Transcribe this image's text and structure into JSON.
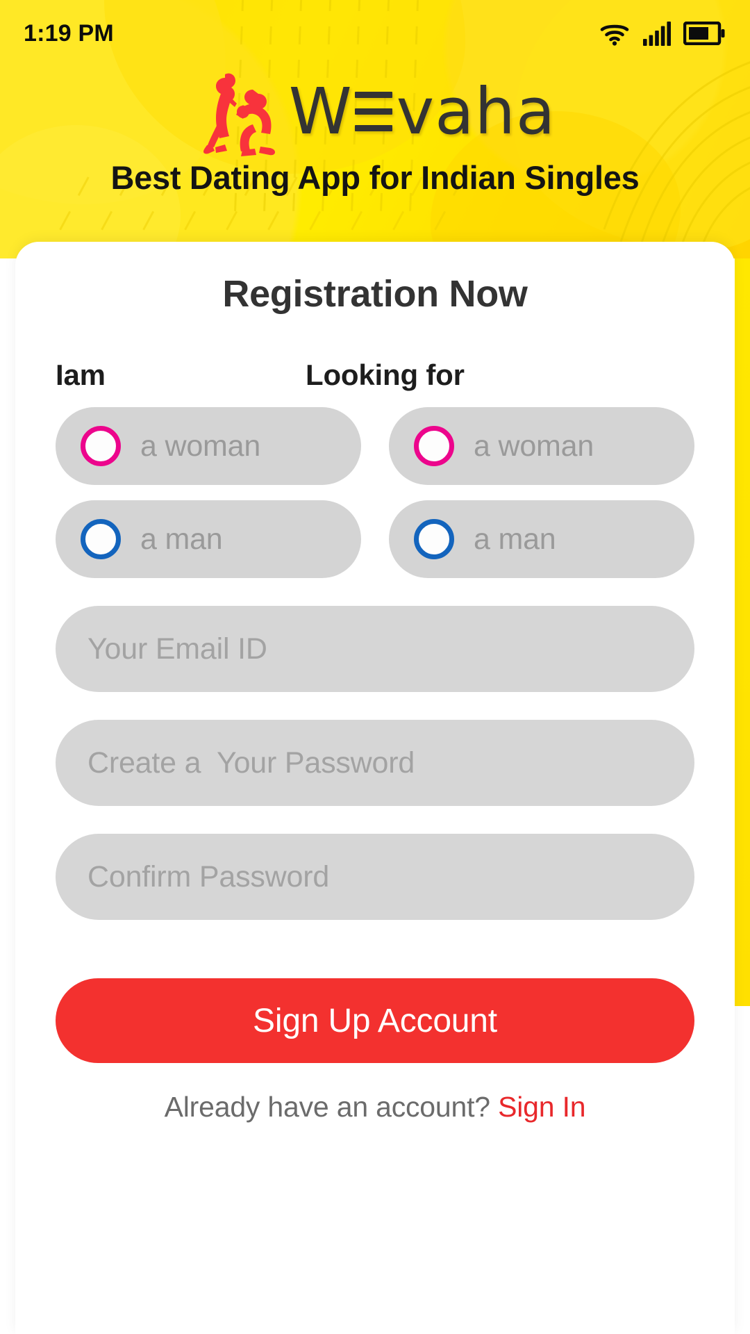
{
  "status_bar": {
    "time": "1:19 PM",
    "icons": [
      "wifi-icon",
      "cellular-signal-icon",
      "battery-icon"
    ]
  },
  "brand": {
    "logo_icon": "couple-proposal-icon",
    "name_part1": "W",
    "name_part2": "vaha",
    "name_full": "WEvaha",
    "tagline": "Best Dating App for Indian Singles",
    "logo_color": "#f8333c",
    "wordmark_color": "#333333",
    "hero_background": "#ffe400"
  },
  "card": {
    "title": "Registration Now",
    "iam": {
      "label": "Iam",
      "options": [
        {
          "label": "a woman",
          "radio_color": "#ec058c",
          "selected": false
        },
        {
          "label": "a man",
          "radio_color": "#1364bd",
          "selected": false
        }
      ]
    },
    "looking_for": {
      "label": "Looking for",
      "options": [
        {
          "label": "a woman",
          "radio_color": "#ec058c",
          "selected": false
        },
        {
          "label": "a man",
          "radio_color": "#1364bd",
          "selected": false
        }
      ]
    },
    "fields": [
      {
        "name": "email",
        "placeholder": "Your Email ID",
        "value": ""
      },
      {
        "name": "password",
        "placeholder": "Create a  Your Password",
        "value": ""
      },
      {
        "name": "confirm_password",
        "placeholder": "Confirm Password",
        "value": ""
      }
    ],
    "submit_label": "Sign Up Account",
    "submit_color": "#f3312f",
    "footer_prompt": "Already have an account?",
    "footer_link": "Sign In",
    "footer_link_color": "#e8282b"
  }
}
